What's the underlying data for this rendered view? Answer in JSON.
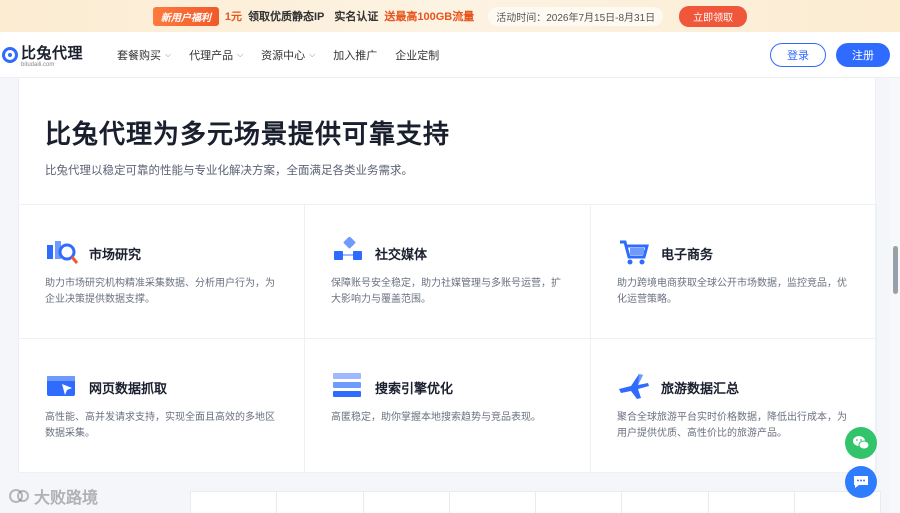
{
  "promo": {
    "tag": "新用户福利",
    "offer": "1元",
    "offer_text": "领取优质静态IP",
    "verify_text": "实名认证",
    "bonus_text": "送最高100GB流量",
    "time_text": "活动时间：2026年7月15日-8月31日",
    "cta": "立即领取"
  },
  "header": {
    "logo_name": "比兔代理",
    "logo_domain": "bitudaili.com",
    "nav": [
      {
        "label": "套餐购买",
        "has_dropdown": true
      },
      {
        "label": "代理产品",
        "has_dropdown": true
      },
      {
        "label": "资源中心",
        "has_dropdown": true
      },
      {
        "label": "加入推广",
        "has_dropdown": false
      },
      {
        "label": "企业定制",
        "has_dropdown": false
      }
    ],
    "login": "登录",
    "register": "注册"
  },
  "main": {
    "title": "比兔代理为多元场景提供可靠支持",
    "subtitle": "比兔代理以稳定可靠的性能与专业化解决方案，全面满足各类业务需求。",
    "scenarios": [
      {
        "title": "市场研究",
        "icon": "market-research-icon",
        "desc": "助力市场研究机构精准采集数据、分析用户行为，为企业决策提供数据支撑。"
      },
      {
        "title": "社交媒体",
        "icon": "social-media-icon",
        "desc": "保障账号安全稳定，助力社媒管理与多账号运营，扩大影响力与覆盖范围。"
      },
      {
        "title": "电子商务",
        "icon": "shopping-cart-icon",
        "desc": "助力跨境电商获取全球公开市场数据，监控竞品，优化运营策略。"
      },
      {
        "title": "网页数据抓取",
        "icon": "web-scraping-icon",
        "desc": "高性能、高并发请求支持，实现全面且高效的多地区数据采集。"
      },
      {
        "title": "搜索引擎优化",
        "icon": "seo-icon",
        "desc": "高匿稳定，助你掌握本地搜索趋势与竞品表现。"
      },
      {
        "title": "旅游数据汇总",
        "icon": "airplane-icon",
        "desc": "聚合全球旅游平台实时价格数据，降低出行成本，为用户提供优质、高性价比的旅游产品。"
      }
    ]
  },
  "watermark": "大败路境",
  "colors": {
    "primary": "#2f6bff",
    "promo_accent": "#e8541e",
    "wechat": "#33c46b"
  }
}
